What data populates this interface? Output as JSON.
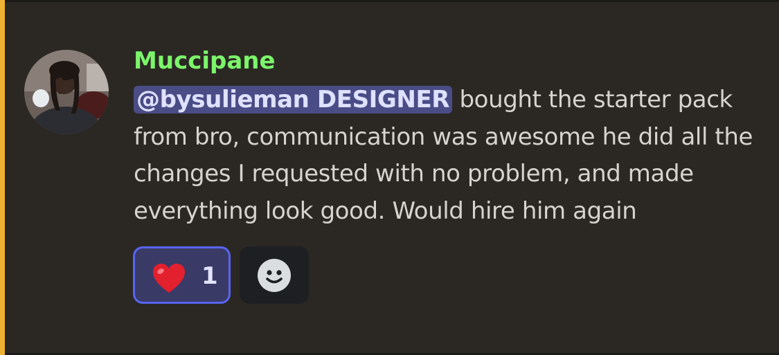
{
  "message": {
    "author": "Muccipane",
    "author_color": "#7cf56b",
    "mention": "@bysulieman DESIGNER",
    "text": " bought the starter pack from bro, communication was awesome he did all the changes I requested with no problem, and made everything look good. Would hire him again"
  },
  "reactions": [
    {
      "icon": "heart-icon",
      "count": "1",
      "selected": true
    }
  ],
  "add_reaction": {
    "icon": "smile-icon"
  },
  "colors": {
    "accent_bar": "#f0b232",
    "mention_bg": "#4a4c86",
    "reaction_border": "#5865f2",
    "background": "#2b2824"
  }
}
